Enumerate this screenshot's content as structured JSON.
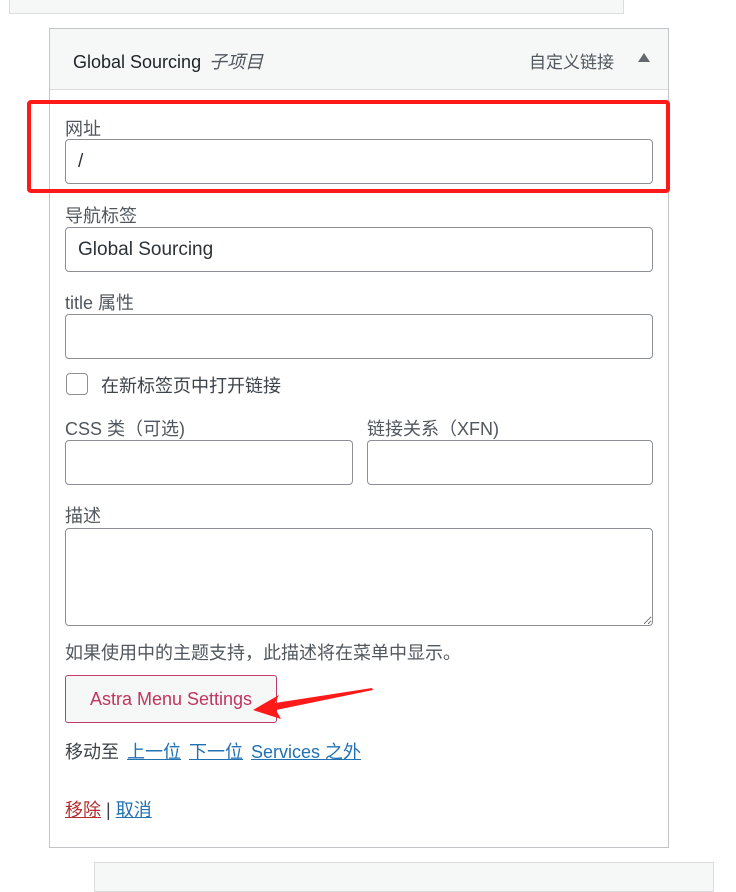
{
  "menu_item": {
    "title": "Global Sourcing",
    "subtitle": "子项目",
    "type": "自定义链接",
    "toggle_icon": "triangle-up-icon"
  },
  "fields": {
    "url": {
      "label": "网址",
      "value": "/"
    },
    "nav_label": {
      "label": "导航标签",
      "value": "Global Sourcing"
    },
    "title_attr": {
      "label": "title 属性",
      "value": ""
    },
    "new_tab": {
      "label": "在新标签页中打开链接",
      "checked": false
    },
    "css_classes": {
      "label": "CSS 类（可选)",
      "value": ""
    },
    "xfn": {
      "label": "链接关系（XFN)",
      "value": ""
    },
    "description": {
      "label": "描述",
      "value": "",
      "help": "如果使用中的主题支持，此描述将在菜单中显示。"
    }
  },
  "astra_button": {
    "label": "Astra Menu Settings"
  },
  "move": {
    "label": "移动至",
    "links": [
      "上一位",
      "下一位",
      "Services 之外"
    ]
  },
  "actions": {
    "remove": "移除",
    "separator": "|",
    "cancel": "取消"
  },
  "annotations": {
    "highlight_color": "#ff1a1a",
    "arrow_color": "#ff1a1a"
  }
}
